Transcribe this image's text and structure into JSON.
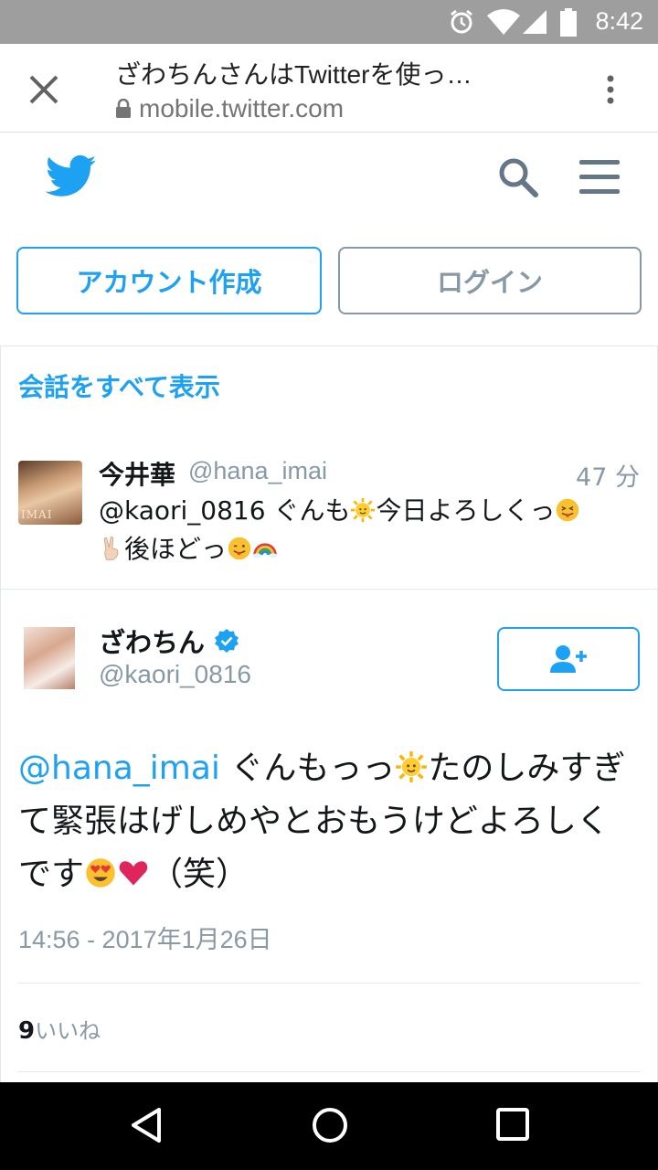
{
  "status_bar": {
    "time": "8:42"
  },
  "browser": {
    "title": "ざわちんさんはTwitterを使っ…",
    "url": "mobile.twitter.com"
  },
  "header": {
    "icons": [
      "twitter-bird-logo",
      "search-icon",
      "hamburger-menu-icon"
    ]
  },
  "buttons": {
    "signup_label": "アカウント作成",
    "login_label": "ログイン"
  },
  "conversation": {
    "show_all_label": "会話をすべて表示"
  },
  "parent_tweet": {
    "name": "今井華",
    "handle": "@hana_imai",
    "time": "47 分",
    "avatar_caption": "IMAI",
    "text_part1": "@kaori_0816 ぐんも",
    "text_part2": "今日よろしくっ",
    "text_part3": "後ほどっ"
  },
  "main_tweet": {
    "name": "ざわちん",
    "handle": "@kaori_0816",
    "mention": "@hana_imai",
    "text_part1": " ぐんもっっ",
    "text_part2": "たのしみすぎて緊張はげしめやとおもうけどよろしくです",
    "text_part3": "（笑）",
    "date": "14:56 - 2017年1月26日",
    "likes_count": "9",
    "likes_label": "いいね"
  },
  "colors": {
    "twitter_blue": "#1da1f2",
    "gray_text": "#8899a6",
    "status_bar": "#9e9e9e",
    "heart": "#e0245e"
  }
}
